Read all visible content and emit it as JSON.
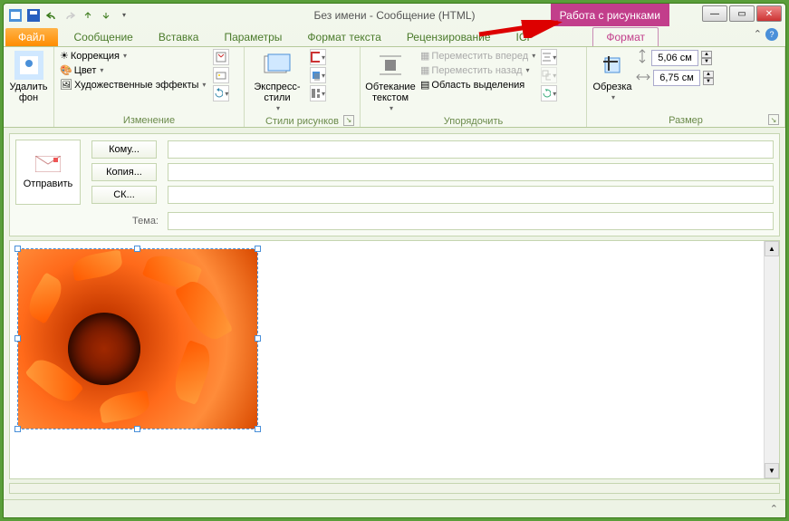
{
  "title": "Без имени  -  Сообщение (HTML)",
  "contextual_tab": "Работа с рисунками",
  "tabs": {
    "file": "Файл",
    "message": "Сообщение",
    "insert": "Вставка",
    "options": "Параметры",
    "format_text": "Формат текста",
    "review": "Рецензирование",
    "icp": "ICP",
    "format": "Формат"
  },
  "ribbon": {
    "remove_bg": {
      "label": "Удалить фон"
    },
    "adjust": {
      "group_label": "Изменение",
      "corrections": "Коррекция",
      "color": "Цвет",
      "artistic": "Художественные эффекты"
    },
    "styles": {
      "group_label": "Стили рисунков",
      "express": "Экспресс-стили"
    },
    "arrange": {
      "group_label": "Упорядочить",
      "wrap": "Обтекание текстом",
      "forward": "Переместить вперед",
      "backward": "Переместить назад",
      "selection_pane": "Область выделения"
    },
    "size": {
      "group_label": "Размер",
      "crop": "Обрезка",
      "height": "5,06 см",
      "width": "6,75 см"
    }
  },
  "compose": {
    "send": "Отправить",
    "to": "Кому...",
    "cc": "Копия...",
    "bcc": "СК...",
    "subject_label": "Тема:"
  }
}
